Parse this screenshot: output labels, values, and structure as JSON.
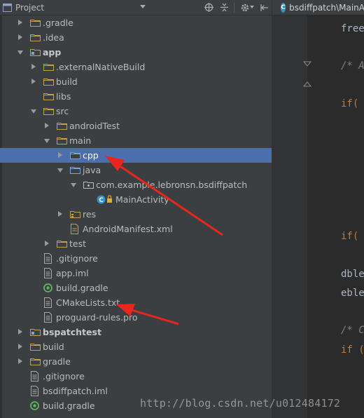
{
  "project_panel": {
    "title": "Project",
    "tree": [
      {
        "label": ".gradle",
        "arrow": "r",
        "icon": "folder",
        "depth": 1,
        "row": 0
      },
      {
        "label": ".idea",
        "arrow": "r",
        "icon": "folder",
        "depth": 1,
        "row": 1
      },
      {
        "label": "app",
        "arrow": "d",
        "icon": "module-folder",
        "depth": 1,
        "row": 2,
        "bold": true
      },
      {
        "label": ".externalNativeBuild",
        "arrow": "r",
        "icon": "folder",
        "depth": 2,
        "row": 3
      },
      {
        "label": "build",
        "arrow": "r",
        "icon": "folder",
        "depth": 2,
        "row": 4
      },
      {
        "label": "libs",
        "arrow": "",
        "icon": "folder",
        "depth": 2,
        "row": 5
      },
      {
        "label": "src",
        "arrow": "d",
        "icon": "folder",
        "depth": 2,
        "row": 6
      },
      {
        "label": "androidTest",
        "arrow": "r",
        "icon": "folder",
        "depth": 3,
        "row": 7
      },
      {
        "label": "main",
        "arrow": "d",
        "icon": "folder",
        "depth": 3,
        "row": 8
      },
      {
        "label": "cpp",
        "arrow": "r",
        "icon": "folder-blue",
        "depth": 4,
        "row": 9,
        "selected": true
      },
      {
        "label": "java",
        "arrow": "d",
        "icon": "folder-blue",
        "depth": 4,
        "row": 10
      },
      {
        "label": "com.example.lebronsn.bsdiffpatch",
        "arrow": "d",
        "icon": "package",
        "depth": 5,
        "row": 11
      },
      {
        "label": "MainActivity",
        "arrow": "",
        "icon": "class",
        "depth": 6,
        "row": 12
      },
      {
        "label": "res",
        "arrow": "r",
        "icon": "res-folder",
        "depth": 4,
        "row": 13
      },
      {
        "label": "AndroidManifest.xml",
        "arrow": "",
        "icon": "manifest",
        "depth": 4,
        "row": 14
      },
      {
        "label": "test",
        "arrow": "r",
        "icon": "folder",
        "depth": 3,
        "row": 15
      },
      {
        "label": ".gitignore",
        "arrow": "",
        "icon": "file",
        "depth": 2,
        "row": 16
      },
      {
        "label": "app.iml",
        "arrow": "",
        "icon": "file",
        "depth": 2,
        "row": 17
      },
      {
        "label": "build.gradle",
        "arrow": "",
        "icon": "gradle",
        "depth": 2,
        "row": 18
      },
      {
        "label": "CMakeLists.txt",
        "arrow": "",
        "icon": "file",
        "depth": 2,
        "row": 19
      },
      {
        "label": "proguard-rules.pro",
        "arrow": "",
        "icon": "file",
        "depth": 2,
        "row": 20
      },
      {
        "label": "bspatchtest",
        "arrow": "r",
        "icon": "module-folder",
        "depth": 1,
        "row": 21,
        "bold": true
      },
      {
        "label": "build",
        "arrow": "r",
        "icon": "folder",
        "depth": 1,
        "row": 22
      },
      {
        "label": "gradle",
        "arrow": "r",
        "icon": "folder",
        "depth": 1,
        "row": 23
      },
      {
        "label": ".gitignore",
        "arrow": "",
        "icon": "file",
        "depth": 1,
        "row": 24
      },
      {
        "label": "bsdiffpatch.iml",
        "arrow": "",
        "icon": "file",
        "depth": 1,
        "row": 25
      },
      {
        "label": "build.gradle",
        "arrow": "",
        "icon": "gradle",
        "depth": 1,
        "row": 26
      }
    ]
  },
  "editor": {
    "tab_label": "bsdiffpatch\\MainA",
    "lines": [
      {
        "text": "free",
        "kind": "plain",
        "row": 0
      },
      {
        "text": "/* A",
        "kind": "cm",
        "row": 1
      },
      {
        "text": "if(",
        "kind": "kw",
        "row": 2
      },
      {
        "text": "if(",
        "kind": "kw",
        "row": 3
      },
      {
        "text": "dble",
        "kind": "plain",
        "row": 4
      },
      {
        "text": "eble",
        "kind": "plain",
        "row": 5
      },
      {
        "text": "/* C",
        "kind": "cm",
        "row": 6
      },
      {
        "text": "if (",
        "kind": "kw",
        "row": 7
      }
    ]
  },
  "watermark": "http://blog.csdn.net/u012484172",
  "colors": {
    "panel_bg": "#3c3f41",
    "selection": "#4b6eaf",
    "editor_bg": "#2b2b2b",
    "arrow_red": "#e8261d"
  }
}
